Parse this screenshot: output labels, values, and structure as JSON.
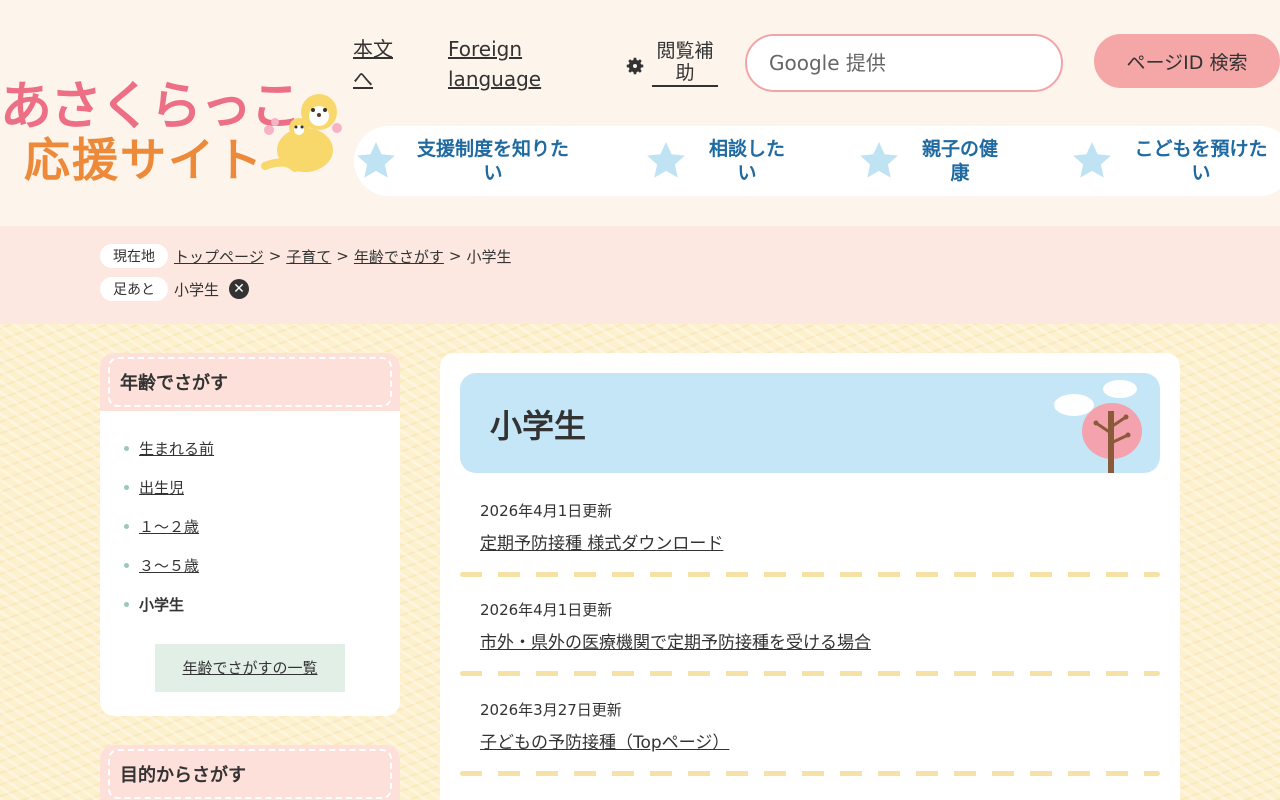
{
  "header": {
    "logo_line1": "あさくらっこ",
    "logo_line2": "応援サイト",
    "skip_link": "本文へ",
    "foreign_link": "Foreign language",
    "assist_label": "閲覧補助",
    "search_placeholder": "Google 提供",
    "search_button": "ページID 検索",
    "nav": [
      {
        "label": "支援制度を知りたい"
      },
      {
        "label": "相談したい"
      },
      {
        "label": "親子の健康"
      },
      {
        "label": "こどもを預けたい"
      }
    ]
  },
  "breadcrumb": {
    "current_tag": "現在地",
    "items": [
      "トップページ",
      "子育て",
      "年齢でさがす"
    ],
    "current": "小学生",
    "footprint_tag": "足あと",
    "footprint_item": "小学生"
  },
  "sidebar": {
    "age": {
      "heading": "年齢でさがす",
      "items": [
        "生まれる前",
        "出生児",
        "１～２歳",
        "３～５歳"
      ],
      "current": "小学生",
      "more": "年齢でさがすの一覧"
    },
    "purpose": {
      "heading": "目的からさがす"
    }
  },
  "main": {
    "title": "小学生",
    "entries": [
      {
        "date": "2026年4月1日更新",
        "link": "定期予防接種 様式ダウンロード"
      },
      {
        "date": "2026年4月1日更新",
        "link": "市外・県外の医療機関で定期予防接種を受ける場合"
      },
      {
        "date": "2026年3月27日更新",
        "link": "子どもの予防接種（Topページ）"
      }
    ]
  },
  "colors": {
    "header_bg": "#fdf4ec",
    "breadcrumb_bg": "#fde8e1",
    "nav_text": "#1f6aa0",
    "search_border": "#f3a4a8",
    "search_button_bg": "#f5a7a7",
    "title_bg": "#c4e6f6",
    "logo_pink": "#ec6f86",
    "logo_orange": "#ed8a3a"
  }
}
